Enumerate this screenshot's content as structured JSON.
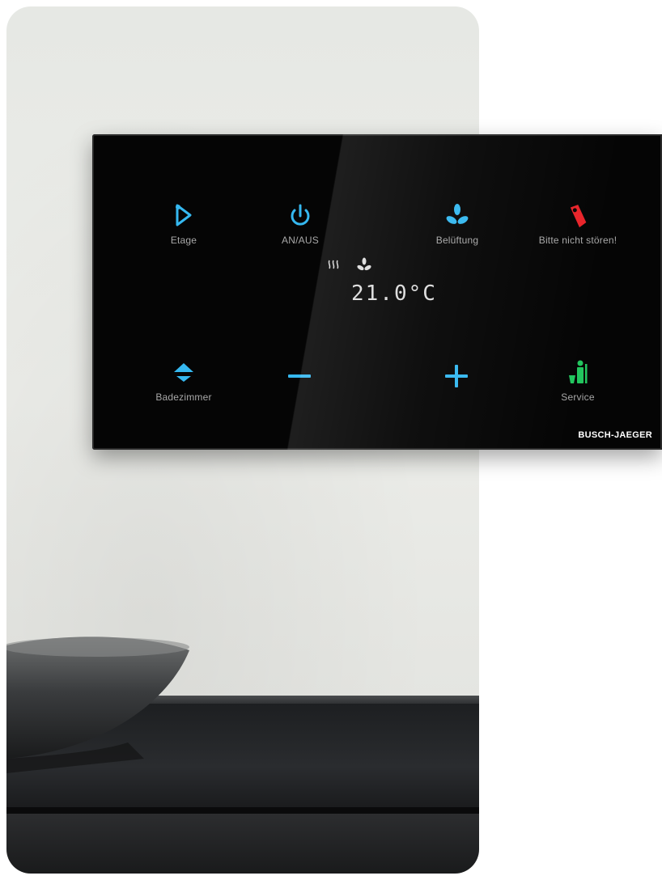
{
  "panel": {
    "buttons": {
      "floor": {
        "label": "Etage"
      },
      "power": {
        "label": "AN/AUS"
      },
      "ventilation": {
        "label": "Belüftung"
      },
      "dnd": {
        "label": "Bitte nicht stören!"
      },
      "bathroom": {
        "label": "Badezimmer"
      },
      "service": {
        "label": "Service"
      }
    },
    "display": {
      "temperature": "21.0°C"
    },
    "brand": "BUSCH-JAEGER"
  },
  "colors": {
    "accent_blue": "#35b8f0",
    "dnd_red": "#e8242a",
    "service_green": "#22c55e",
    "panel_black": "#050505"
  },
  "icons": {
    "floor": "lamp-icon",
    "power": "power-icon",
    "ventilation": "fan-icon",
    "dnd": "door-hanger-icon",
    "bathroom": "ceiling-light-icon",
    "minus": "minus-icon",
    "plus": "plus-icon",
    "service": "cleaning-icon",
    "heat": "heating-icon"
  }
}
